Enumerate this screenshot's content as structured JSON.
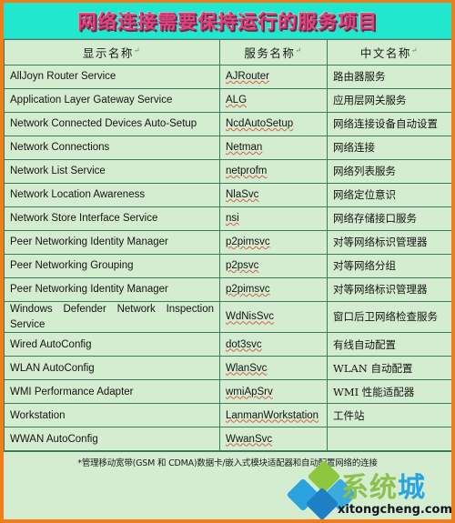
{
  "title": "网络连接需要保持运行的服务项目",
  "colors": {
    "border": "#ef7d1a",
    "banner_bg": "#1fe8cf",
    "title_fg": "#e0447f",
    "table_bg": "#d4ecd0",
    "grid": "#3c7a5c",
    "watermark_green": "#8ec04e",
    "watermark_blue": "#2aa3e0"
  },
  "table": {
    "headers": [
      "显示名称",
      "服务名称",
      "中文名称"
    ],
    "rows": [
      {
        "display": "AllJoyn Router Service",
        "service": "AJRouter",
        "cn": "路由器服务"
      },
      {
        "display": "Application Layer Gateway Service",
        "service": "ALG",
        "cn": "应用层网关服务"
      },
      {
        "display": "Network Connected Devices Auto-Setup",
        "service": "NcdAutoSetup",
        "cn": "网络连接设备自动设置"
      },
      {
        "display": "Network Connections",
        "service": "Netman",
        "cn": "网络连接"
      },
      {
        "display": "Network List Service",
        "service": "netprofm",
        "cn": "网络列表服务"
      },
      {
        "display": "Network Location Awareness",
        "service": "NlaSvc",
        "cn": "网络定位意识"
      },
      {
        "display": "Network Store Interface Service",
        "service": "nsi",
        "cn": "网络存储接口服务"
      },
      {
        "display": "Peer Networking Identity Manager",
        "service": "p2pimsvc",
        "cn": "对等网络标识管理器"
      },
      {
        "display": "Peer Networking Grouping",
        "service": "p2psvc",
        "cn": "对等网络分组"
      },
      {
        "display": "Peer Networking Identity Manager",
        "service": "p2pimsvc",
        "cn": "对等网络标识管理器"
      },
      {
        "display": "Windows Defender Network Inspection Service",
        "service": "WdNisSvc",
        "cn": "窗口后卫网络检查服务",
        "tall": true
      },
      {
        "display": "Wired AutoConfig",
        "service": "dot3svc",
        "cn": "有线自动配置"
      },
      {
        "display": "WLAN AutoConfig",
        "service": "WlanSvc",
        "cn": "WLAN 自动配置"
      },
      {
        "display": "WMI Performance Adapter",
        "service": "wmiApSrv",
        "cn": "WMI 性能适配器"
      },
      {
        "display": "Workstation",
        "service": "LanmanWorkstation",
        "cn": "工件站"
      },
      {
        "display": "WWAN AutoConfig",
        "service": "WwanSvc",
        "cn": ""
      }
    ]
  },
  "footnote": "*管理移动宽带(GSM 和 CDMA)数据卡/嵌入式模块适配器和自动配置网络的连接",
  "watermark": {
    "brand_prefix": "系统",
    "brand_suffix": "城",
    "url": "xitongcheng.com"
  }
}
